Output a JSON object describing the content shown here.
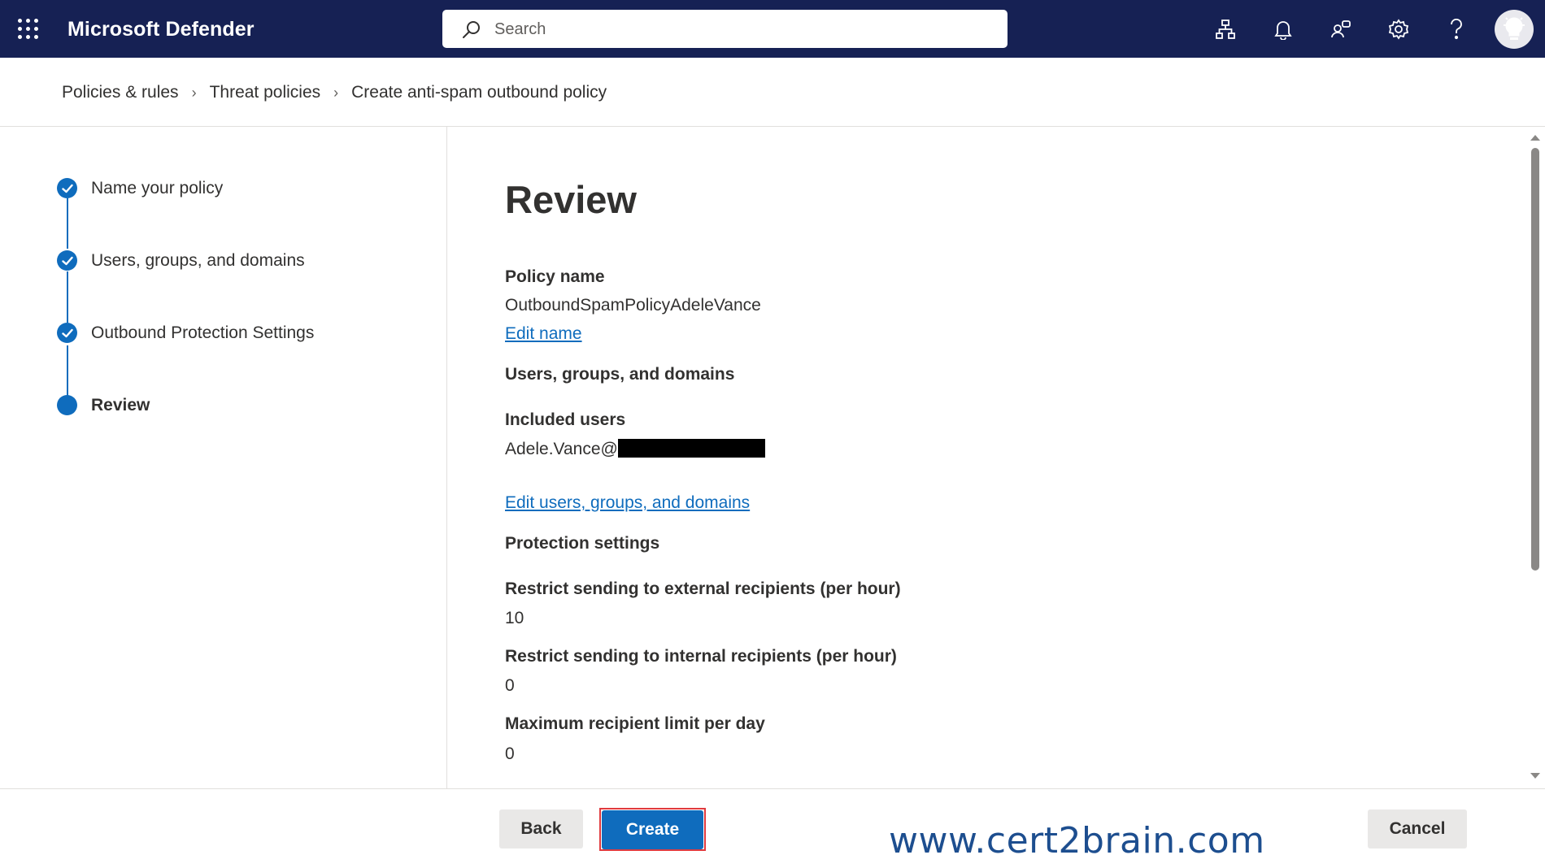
{
  "topbar": {
    "app_title": "Microsoft Defender",
    "search_placeholder": "Search",
    "icons": [
      "waffle-icon",
      "search-icon",
      "org-chart-icon",
      "bell-icon",
      "people-chat-icon",
      "gear-icon",
      "help-icon",
      "lightbulb-icon"
    ]
  },
  "breadcrumb": {
    "items": [
      "Policies & rules",
      "Threat policies",
      "Create anti-spam outbound policy"
    ]
  },
  "steps": [
    {
      "label": "Name your policy",
      "state": "completed"
    },
    {
      "label": "Users, groups, and domains",
      "state": "completed"
    },
    {
      "label": "Outbound Protection Settings",
      "state": "completed"
    },
    {
      "label": "Review",
      "state": "current"
    }
  ],
  "review": {
    "heading": "Review",
    "policy_name_label": "Policy name",
    "policy_name_value": "OutboundSpamPolicyAdeleVance",
    "edit_name_link": "Edit name",
    "users_section_label": "Users, groups, and domains",
    "included_users_label": "Included users",
    "included_users_value": "Adele.Vance@",
    "edit_users_link": "Edit users, groups, and domains",
    "protection_section_label": "Protection settings",
    "external_limit_label": "Restrict sending to external recipients (per hour)",
    "external_limit_value": "10",
    "internal_limit_label": "Restrict sending to internal recipients (per hour)",
    "internal_limit_value": "0",
    "daily_limit_label": "Maximum recipient limit per day",
    "daily_limit_value": "0"
  },
  "footer": {
    "back_label": "Back",
    "create_label": "Create",
    "cancel_label": "Cancel",
    "watermark": "www.cert2brain.com"
  },
  "colors": {
    "topbar": "#162154",
    "accent": "#0f6cbd",
    "highlight": "#e03a3e"
  }
}
